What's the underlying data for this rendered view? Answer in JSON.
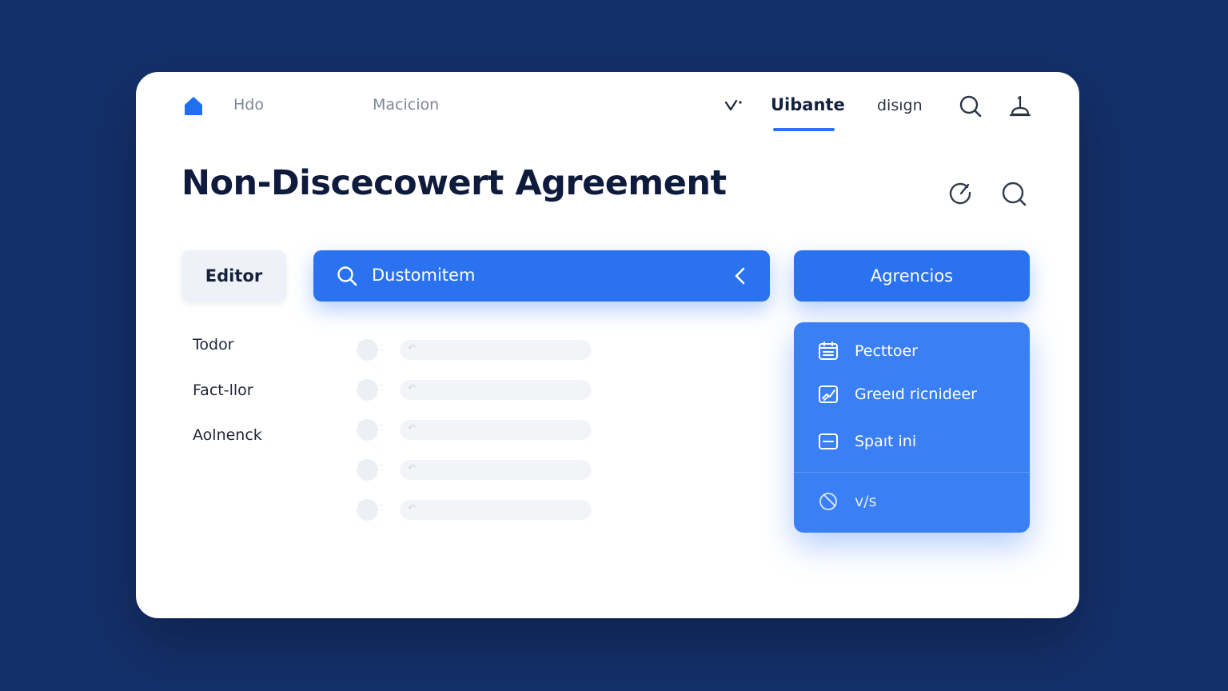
{
  "nav": {
    "links": [
      "Hdo",
      "Macicion"
    ],
    "v_label": "",
    "active_tab": "Uibante",
    "tab": "disıgn"
  },
  "title": "Non-Discecowert Agreement",
  "toolbar": {
    "editor_label": "Editor",
    "search_value": "Dustomitem",
    "agencios_label": "Agrencios"
  },
  "left_list": [
    "Todor",
    "Fact-llor",
    "Aolnenck"
  ],
  "skeleton": {
    "colon": ":",
    "glyph": "↶"
  },
  "menu": {
    "items": [
      {
        "label": "Pecttoer",
        "icon": "calendar-icon"
      },
      {
        "label": "Greeıd ricnideer",
        "icon": "chart-card-icon"
      },
      {
        "label": "Spaıt ini",
        "icon": "card-icon"
      },
      {
        "label": "v/s",
        "icon": "tag-icon"
      }
    ]
  },
  "colors": {
    "background": "#14306a",
    "accent": "#2a72f0",
    "menu": "#3a7ff4",
    "title": "#0f1b3d"
  }
}
